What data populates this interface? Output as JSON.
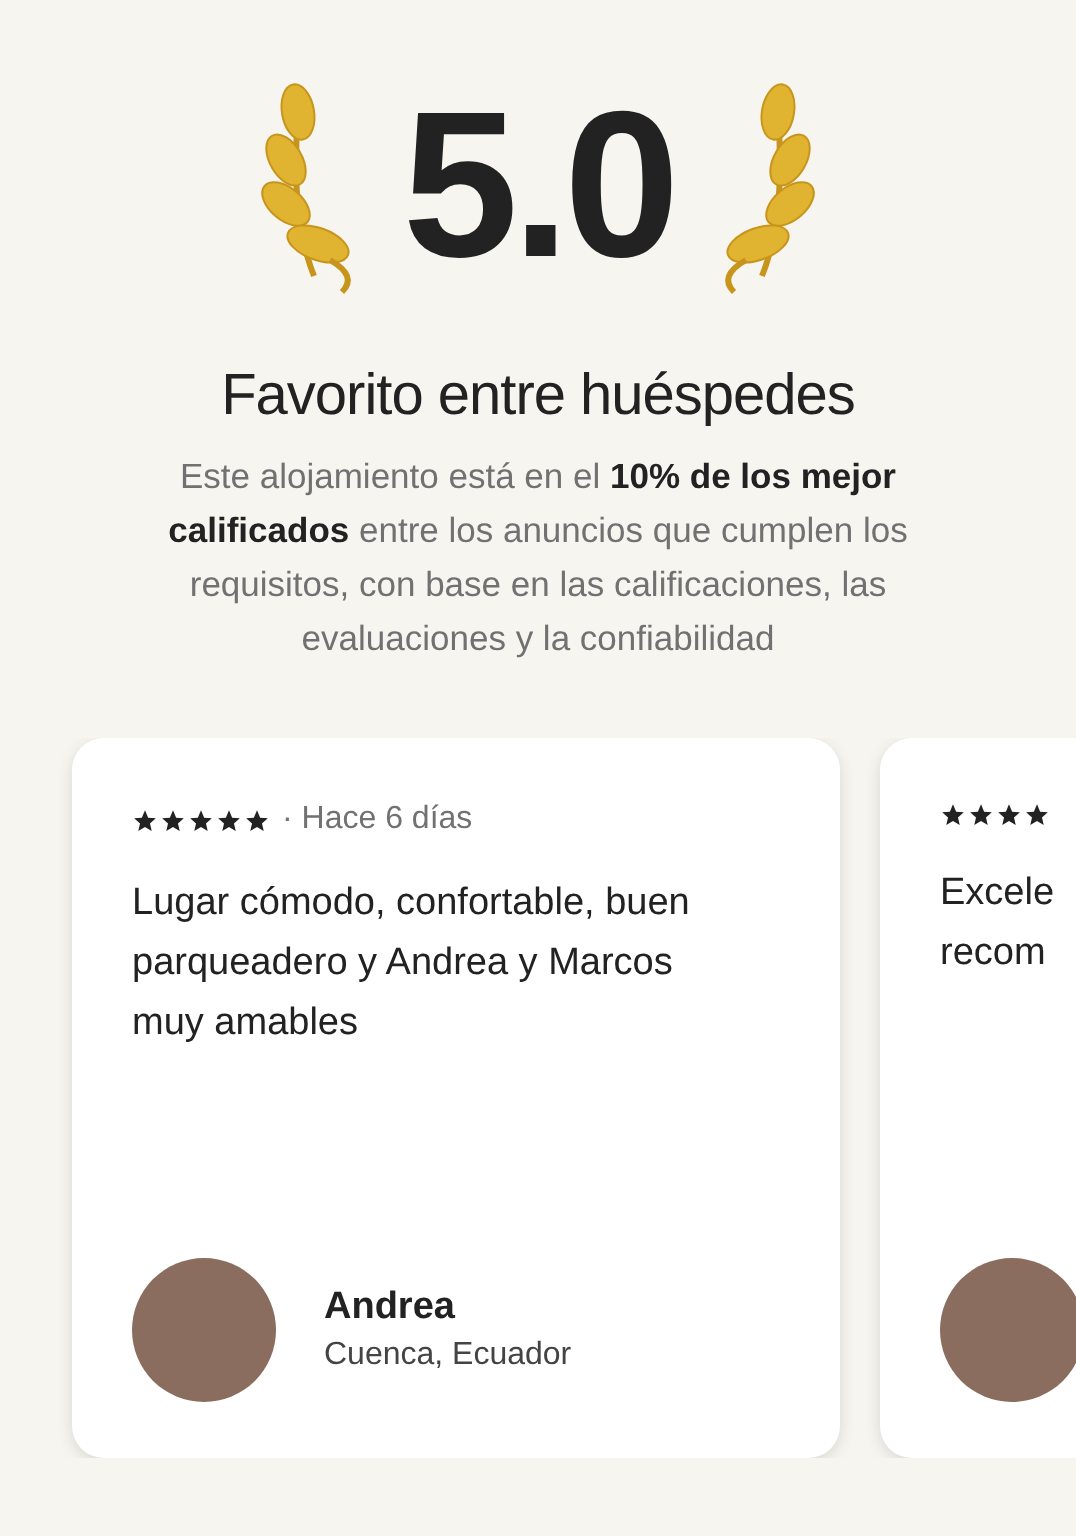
{
  "rating": "5.0",
  "title": "Favorito entre huéspedes",
  "description": "Este alojamiento está en el **10% de los mejor calificados** entre los anuncios que cumplen los requisitos, con base en las calificaciones, las evaluaciones y la confiabilidad",
  "reviews": [
    {
      "stars": 5,
      "time": "· Hace 6 días",
      "text": [
        "Lugar cómodo, confortable, buen",
        "parqueadero y Andrea y Marcos",
        "muy amables"
      ],
      "name": "Andrea",
      "location": "Cuenca, Ecuador"
    },
    {
      "stars": 4,
      "text": [
        "Excele",
        "recom"
      ]
    }
  ]
}
